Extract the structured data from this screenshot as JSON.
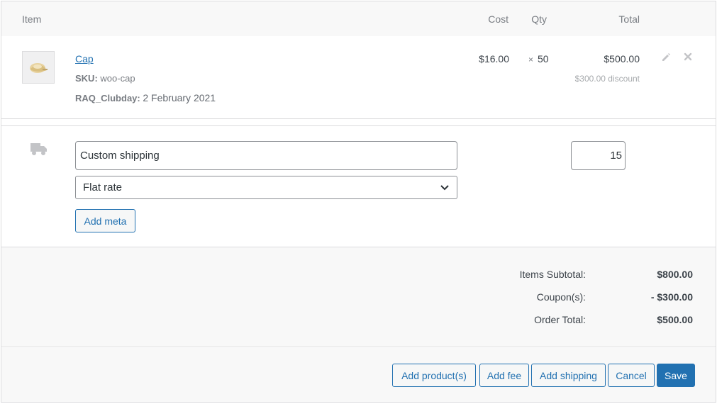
{
  "header": {
    "item": "Item",
    "cost": "Cost",
    "qty": "Qty",
    "total": "Total"
  },
  "item": {
    "name": "Cap",
    "sku_label": "SKU:",
    "sku_value": "woo-cap",
    "meta_label": "RAQ_Clubday:",
    "meta_value": "2 February 2021",
    "cost": "$16.00",
    "qty_symbol": "×",
    "qty": "50",
    "total": "$500.00",
    "discount": "$300.00 discount",
    "thumbnail_icon": "cap-thumbnail"
  },
  "shipping": {
    "name_value": "Custom shipping",
    "method_selected": "Flat rate",
    "add_meta_label": "Add meta",
    "cost_value": "15",
    "icon": "truck-icon"
  },
  "totals": [
    {
      "label": "Items Subtotal:",
      "value": "$800.00"
    },
    {
      "label": "Coupon(s):",
      "value": "- $300.00"
    },
    {
      "label": "Order Total:",
      "value": "$500.00"
    }
  ],
  "buttons": {
    "add_products": "Add product(s)",
    "add_fee": "Add fee",
    "add_shipping": "Add shipping",
    "cancel": "Cancel",
    "save": "Save"
  },
  "colors": {
    "accent": "#2271b1",
    "border": "#dcdcde",
    "muted": "#787c82"
  }
}
